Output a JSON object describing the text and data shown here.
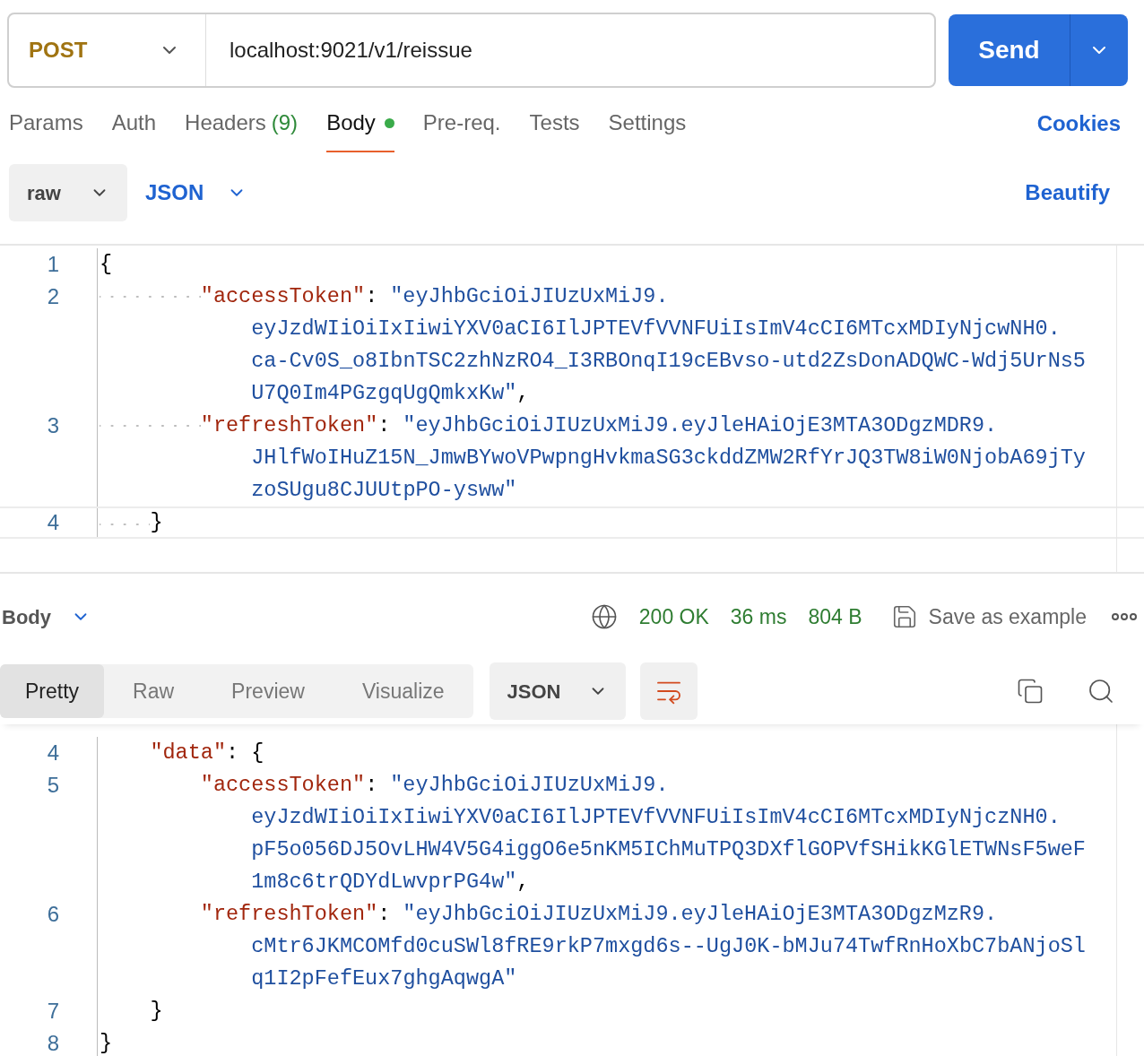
{
  "request": {
    "method": "POST",
    "url": "localhost:9021/v1/reissue",
    "send": "Send"
  },
  "tabs": [
    {
      "label": "Params",
      "selected": false,
      "indicator": false
    },
    {
      "label": "Auth",
      "selected": false,
      "indicator": false
    },
    {
      "label": "Headers",
      "count": "(9)",
      "selected": false,
      "indicator": false
    },
    {
      "label": "Body",
      "selected": true,
      "indicator": true
    },
    {
      "label": "Pre-req.",
      "selected": false,
      "indicator": false
    },
    {
      "label": "Tests",
      "selected": false,
      "indicator": false
    },
    {
      "label": "Settings",
      "selected": false,
      "indicator": false
    }
  ],
  "cookies": "Cookies",
  "body_options": {
    "mode": "raw",
    "language": "JSON",
    "beautify": "Beautify"
  },
  "request_editor": {
    "lines": [
      {
        "kind": "line",
        "number": "1",
        "text": "{",
        "current": false
      },
      {
        "kind": "group",
        "children": [
          {
            "kind": "group",
            "children": [
              {
                "kind": "pair",
                "number": "2",
                "key": "\"accessToken\"",
                "separator": ":",
                "value_lines": [
                  "\"eyJhbGciOiJIUzUxMiJ9.",
                  "eyJzdWIiOiIxIiwiYXV0aCI6IlJPTEVfVVNFUiIsImV4cCI6MTcxMDIyNjcwNH0.",
                  "ca-Cv0S_o8IbnTSC2zhNzRO4_I3RBOnqI19cEBvso-utd2ZsDonADQWC-Wdj5UrNs5",
                  "U7Q0Im4PGzgqUgQmkxKw\""
                ],
                "trail": ",",
                "current": false
              },
              {
                "kind": "pair",
                "number": "3",
                "key": "\"refreshToken\"",
                "separator": ":",
                "value_lines": [
                  "\"eyJhbGciOiJIUzUxMiJ9.eyJleHAiOjE3MTA3ODgzMDR9.",
                  "JHlfWoIHuZ15N_JmwBYwoVPwpngHvkmaSG3ckddZMW2RfYrJQ3TW8iW0NjobA69jTy",
                  "zoSUgu8CJUUtpPO-ysww\""
                ],
                "current": false
              }
            ]
          },
          {
            "kind": "line",
            "number": "4",
            "text": "}",
            "current": true
          }
        ]
      }
    ]
  },
  "response": {
    "section": "Body",
    "status": "200 OK",
    "time": "36 ms",
    "size": "804 B",
    "save": "Save as example",
    "views": [
      {
        "label": "Pretty",
        "selected": true
      },
      {
        "label": "Raw",
        "selected": false
      },
      {
        "label": "Preview",
        "selected": false
      },
      {
        "label": "Visualize",
        "selected": false
      }
    ],
    "format": "JSON",
    "wrap": true
  },
  "response_editor": {
    "lines": [
      {
        "kind": "group",
        "children": [
          {
            "kind": "pair",
            "number": "4",
            "key": "\"data\"",
            "separator": ":",
            "value_lines": [
              "{"
            ],
            "current": false,
            "children": [
              {
                "kind": "pair",
                "number": "5",
                "key": "\"accessToken\"",
                "separator": ":",
                "value_lines": [
                  "\"eyJhbGciOiJIUzUxMiJ9.",
                  "eyJzdWIiOiIxIiwiYXV0aCI6IlJPTEVfVVNFUiIsImV4cCI6MTcxMDIyNjczNH0.",
                  "pF5o056DJ5OvLHW4V5G4iggO6e5nKM5IChMuTPQ3DXflGOPVfSHikKGlETWNsF5weF",
                  "1m8c6trQDYdLwvprPG4w\""
                ],
                "trail": ",",
                "current": false
              },
              {
                "kind": "pair",
                "number": "6",
                "key": "\"refreshToken\"",
                "separator": ":",
                "value_lines": [
                  "\"eyJhbGciOiJIUzUxMiJ9.eyJleHAiOjE3MTA3ODgzMzR9.",
                  "cMtr6JKMCOMfd0cuSWl8fRE9rkP7mxgd6s--UgJ0K-bMJu74TwfRnHoXbC7bANjoSl",
                  "q1I2pFefEux7ghgAqwgA\""
                ],
                "current": false
              }
            ]
          },
          {
            "kind": "line",
            "number": "7",
            "text": "}",
            "current": false
          }
        ]
      },
      {
        "kind": "line",
        "number": "8",
        "text": "}",
        "current": false
      }
    ]
  }
}
